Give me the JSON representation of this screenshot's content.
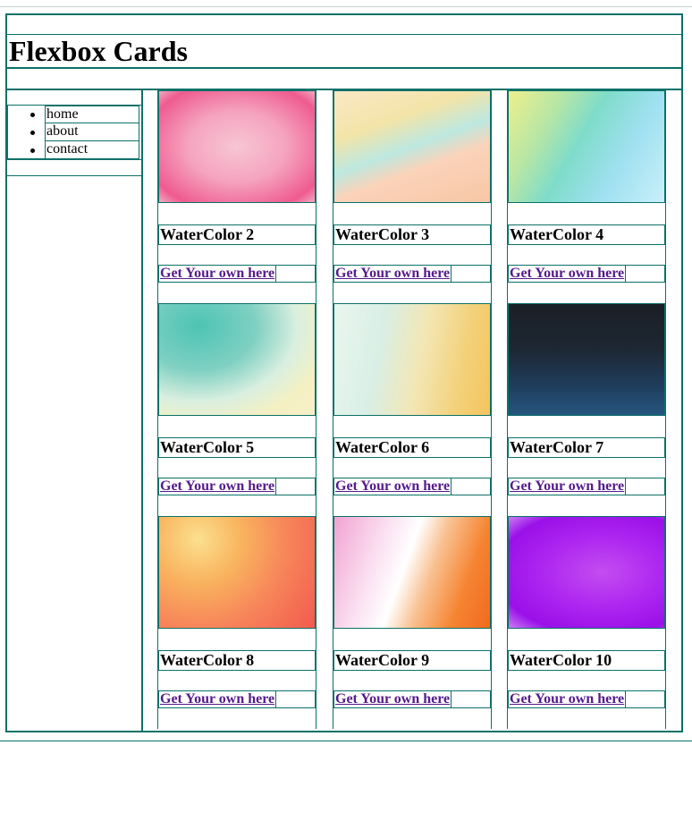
{
  "header": {
    "title": "Flexbox Cards"
  },
  "nav": {
    "items": [
      {
        "label": "home"
      },
      {
        "label": "about"
      },
      {
        "label": "contact"
      }
    ]
  },
  "cards": [
    {
      "title": "WaterColor 2",
      "link": "Get Your own here",
      "image": "pink watercolor"
    },
    {
      "title": "WaterColor 3",
      "link": "Get Your own here",
      "image": "peach and aqua watercolor"
    },
    {
      "title": "WaterColor 4",
      "link": "Get Your own here",
      "image": "yellow green blue watercolor"
    },
    {
      "title": "WaterColor 5",
      "link": "Get Your own here",
      "image": "teal and cream watercolor"
    },
    {
      "title": "WaterColor 6",
      "link": "Get Your own here",
      "image": "mint and yellow watercolor"
    },
    {
      "title": "WaterColor 7",
      "link": "Get Your own here",
      "image": "dark navy watercolor"
    },
    {
      "title": "WaterColor 8",
      "link": "Get Your own here",
      "image": "orange and red watercolor"
    },
    {
      "title": "WaterColor 9",
      "link": "Get Your own here",
      "image": "pink white orange watercolor"
    },
    {
      "title": "WaterColor 10",
      "link": "Get Your own here",
      "image": "purple watercolor"
    }
  ],
  "colors": {
    "border": "#0b7168",
    "link": "#551a8b"
  }
}
